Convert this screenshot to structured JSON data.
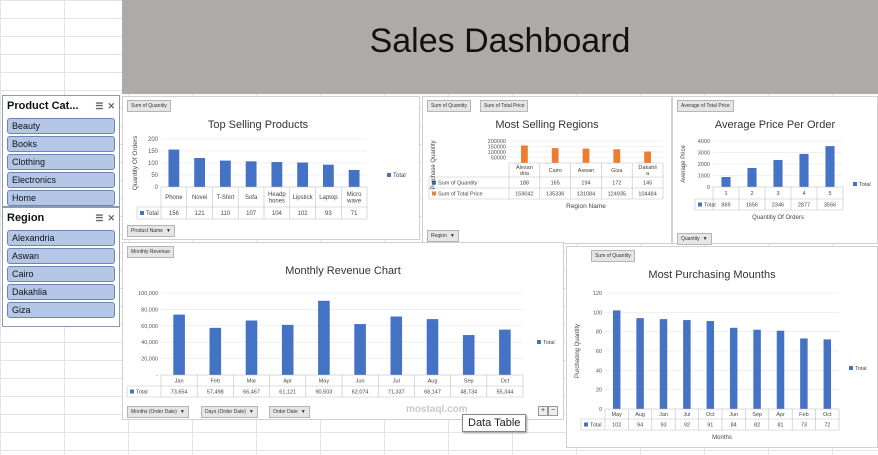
{
  "dashboard": {
    "title": "Sales Dashboard"
  },
  "slicers": {
    "product": {
      "title": "Product Cat...",
      "items": [
        "Beauty",
        "Books",
        "Clothing",
        "Electronics",
        "Home"
      ]
    },
    "region": {
      "title": "Region",
      "items": [
        "Alexandria",
        "Aswan",
        "Cairo",
        "Dakahlia",
        "Giza"
      ]
    }
  },
  "colors": {
    "bar": "#4472c4",
    "orange": "#ed7d31",
    "banner": "#aeaaaa"
  },
  "icons": {
    "multiselect": "multi-select-icon",
    "clear": "clear-filter-icon"
  },
  "charts": {
    "top_products": {
      "field_button": "Sum of Quantity",
      "axis_button": "Product Name",
      "title": "Top Selling Products",
      "ylabel": "Quantity Of Orders",
      "legend": "Total"
    },
    "regions": {
      "field_buttons": [
        "Sum of Quantity",
        "Sum of Total Price"
      ],
      "axis_button": "Region",
      "title": "Most Selling Regions",
      "ylabel": "Purchase Quantity",
      "xlabel": "Region Name"
    },
    "avg_price": {
      "field_button": "Average of Total Price",
      "axis_button": "Quantity",
      "title": "Average Price Per Order",
      "ylabel": "Average Price",
      "xlabel": "Quantitiy Of Orders",
      "legend": "Total"
    },
    "monthly_revenue": {
      "field_button": "Monthly Revenue",
      "axis_buttons": [
        "Months (Order Date)",
        "Days (Order Date)",
        "Order Date"
      ],
      "title": "Monthly Revenue Chart",
      "legend": "Total"
    },
    "purchasing_months": {
      "field_button": "Sum of Quantity",
      "title": "Most Purchasing Mounths",
      "ylabel": "Purchasing Quantity",
      "xlabel": "Months",
      "legend": "Total"
    }
  },
  "tooltip": {
    "text": "Data Table"
  },
  "watermark": {
    "text": "mostaql.com"
  },
  "chart_data": [
    {
      "type": "bar",
      "title": "Top Selling Products",
      "ylabel": "Quantity Of Orders",
      "xlabel": "",
      "ylim": [
        0,
        200
      ],
      "yticks": [
        "0",
        "50",
        "100",
        "150",
        "200"
      ],
      "categories": [
        "Phone",
        "Novel",
        "T-Shirt",
        "Sofa",
        "Headphones",
        "Lipstick",
        "Laptop",
        "Microwave"
      ],
      "category_labels": [
        [
          "Phone"
        ],
        [
          "Novel"
        ],
        [
          "T-Shirt"
        ],
        [
          "Sofa"
        ],
        [
          "Headp",
          "hones"
        ],
        [
          "Lipstick"
        ],
        [
          "Laptop"
        ],
        [
          "Micro",
          "wave"
        ]
      ],
      "series": [
        {
          "name": "Total",
          "values": [
            156,
            121,
            110,
            107,
            104,
            102,
            93,
            71
          ]
        }
      ],
      "table_row_label": "Total",
      "legend": "right"
    },
    {
      "type": "bar",
      "title": "Most Selling Regions",
      "ylabel": "Purchase Quantity",
      "xlabel": "Region Name",
      "ylim": [
        0,
        200000
      ],
      "yticks": [
        "50000",
        "100000",
        "150000",
        "200000"
      ],
      "categories": [
        "Alexandria",
        "Cairo",
        "Aswan",
        "Giza",
        "Dakahlia"
      ],
      "category_labels": [
        [
          "Alexan",
          "dria"
        ],
        [
          "Cairo"
        ],
        [
          "Aswan"
        ],
        [
          "Giza"
        ],
        [
          "Dakahli",
          "a"
        ]
      ],
      "series": [
        {
          "name": "Sum of Quantity",
          "values": [
            188,
            165,
            194,
            172,
            145
          ]
        },
        {
          "name": "Sum of Total Price",
          "values": [
            159042,
            135336,
            131084,
            124935,
            104484
          ]
        }
      ]
    },
    {
      "type": "bar",
      "title": "Average Price Per Order",
      "ylabel": "Average Price",
      "xlabel": "Quantitiy Of Orders",
      "ylim": [
        0,
        4000
      ],
      "yticks": [
        "0",
        "1000",
        "2000",
        "3000",
        "4000"
      ],
      "categories": [
        "1",
        "2",
        "3",
        "4",
        "5"
      ],
      "series": [
        {
          "name": "Total",
          "values": [
            869,
            1656,
            2346,
            2877,
            3556
          ]
        }
      ],
      "table_row_label": "Total",
      "legend": "right"
    },
    {
      "type": "bar",
      "title": "Monthly Revenue Chart",
      "ylabel": "",
      "xlabel": "",
      "ylim": [
        0,
        100000
      ],
      "yticks": [
        "-",
        "20,000",
        "40,000",
        "60,000",
        "80,000",
        "100,000"
      ],
      "categories": [
        "Jan",
        "Feb",
        "Mar",
        "Apr",
        "May",
        "Jun",
        "Jul",
        "Aug",
        "Sep",
        "Oct"
      ],
      "series": [
        {
          "name": "Total",
          "values": [
            73654,
            57498,
            66467,
            61121,
            90503,
            62074,
            71337,
            68147,
            48734,
            55344
          ]
        }
      ],
      "table_row_label": "Total",
      "legend": "right"
    },
    {
      "type": "bar",
      "title": "Most Purchasing Mounths",
      "ylabel": "Purchasing Quantity",
      "xlabel": "Months",
      "ylim": [
        0,
        120
      ],
      "yticks": [
        "0",
        "20",
        "40",
        "60",
        "80",
        "100",
        "120"
      ],
      "categories": [
        "May",
        "Aug",
        "Jan",
        "Jul",
        "Oct",
        "Jun",
        "Sep",
        "Apr",
        "Feb",
        "Oct"
      ],
      "series": [
        {
          "name": "Total",
          "values": [
            102,
            94,
            93,
            92,
            91,
            84,
            82,
            81,
            73,
            72
          ]
        }
      ],
      "table_row_label": "Total",
      "legend": "right"
    }
  ]
}
